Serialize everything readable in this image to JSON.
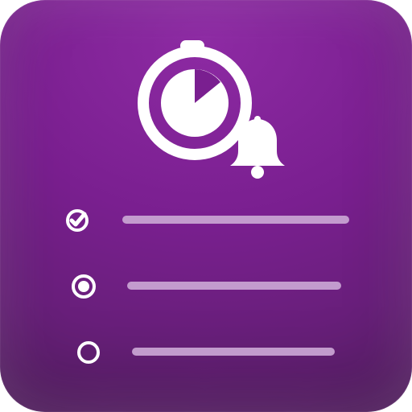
{
  "icon": {
    "theme": {
      "accent": "#ffffff",
      "bar_color": "#c7a2d2",
      "bg_top": "#8d2aa3",
      "bg_mid": "#7a1f90",
      "bg_bottom": "#5a1f69"
    },
    "symbols": {
      "stopwatch_icon": "stopwatch-icon",
      "bell_icon": "bell-icon",
      "checkbox_checked_icon": "checkbox-checked-icon",
      "radio_selected_icon": "radio-selected-icon",
      "radio_unselected_icon": "radio-unselected-icon"
    }
  }
}
